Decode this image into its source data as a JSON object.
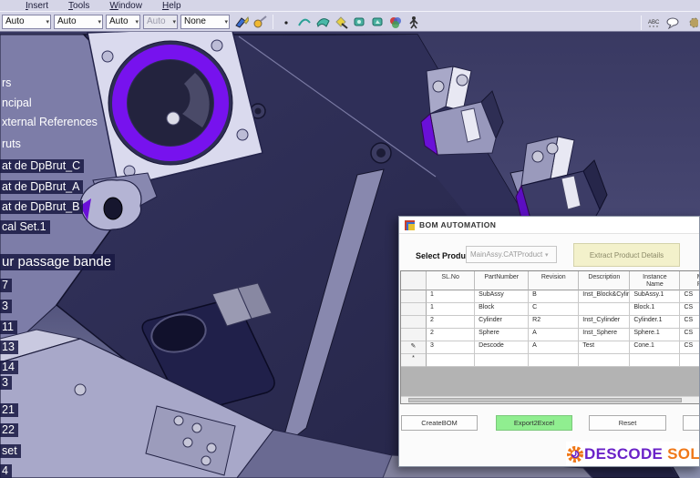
{
  "menu_bar": {
    "items": [
      {
        "label": "Insert"
      },
      {
        "label": "Tools"
      },
      {
        "label": "Window"
      },
      {
        "label": "Help"
      }
    ]
  },
  "toolbar": {
    "dropdowns": [
      {
        "value": "Auto",
        "disabled": false
      },
      {
        "value": "Auto",
        "disabled": false
      },
      {
        "value": "Auto",
        "disabled": false
      },
      {
        "value": "Auto",
        "disabled": true
      },
      {
        "value": "None",
        "disabled": false
      }
    ],
    "icons": [
      "paint-brush",
      "airbrush",
      "point",
      "curve",
      "surface",
      "gem-pencil",
      "render-view",
      "render-view-alt",
      "materials",
      "mannequin",
      "abc-text",
      "speech-balloon",
      "partial-gear"
    ]
  },
  "tree": {
    "items": [
      {
        "label": "rs"
      },
      {
        "label": "ncipal"
      },
      {
        "label": "xternal References"
      },
      {
        "label": "ruts"
      },
      {
        "label": "at de DpBrut_C"
      },
      {
        "label": "at de DpBrut_A"
      },
      {
        "label": "at de DpBrut_B"
      },
      {
        "label": "cal Set.1"
      },
      {
        "label": "ur passage bande"
      },
      {
        "label": "7"
      },
      {
        "label": "3"
      },
      {
        "label": "11"
      },
      {
        "label": "13"
      },
      {
        "label": "14"
      },
      {
        "label": "3"
      },
      {
        "label": "21"
      },
      {
        "label": "22"
      },
      {
        "label": "set"
      },
      {
        "label": "4"
      }
    ]
  },
  "viewport": {
    "colors": {
      "background_top": "#3A3A62",
      "background_bottom": "#8B90AE",
      "part_dark_navy": "#28284E",
      "part_light_face": "#D9D9EC",
      "bore_accent_purple": "#7712EE"
    }
  },
  "dialog": {
    "title": "BOM AUTOMATION",
    "select_product_label": "Select Product",
    "product_combo_value": "MainAssy.CATProduct",
    "extract_button_label": "Extract Product Details",
    "grid": {
      "columns": [
        "SL.No",
        "PartNumber",
        "Revision",
        "Description",
        "Instance\nName",
        "M\nP."
      ],
      "rows": [
        {
          "sl": "1",
          "part": "SubAssy",
          "rev": "B",
          "desc": "Inst_Block&Cylin...",
          "inst": "SubAssy.1",
          "mp": "CS"
        },
        {
          "sl": "1",
          "part": "Block",
          "rev": "C",
          "desc": "",
          "inst": "Block.1",
          "mp": "CS"
        },
        {
          "sl": "2",
          "part": "Cylinder",
          "rev": "R2",
          "desc": "Inst_Cylinder",
          "inst": "Cylinder.1",
          "mp": "CS"
        },
        {
          "sl": "2",
          "part": "Sphere",
          "rev": "A",
          "desc": "Inst_Sphere",
          "inst": "Sphere.1",
          "mp": "CS"
        },
        {
          "sl": "3",
          "part": "Descode",
          "rev": "A",
          "desc": "Test",
          "inst": "Cone.1",
          "mp": "CS"
        }
      ],
      "edit_row_indicator": "✎",
      "new_row_indicator": "*"
    },
    "buttons": [
      {
        "label": "CreateBOM"
      },
      {
        "label": "Export2Excel",
        "color": "#90EE90"
      },
      {
        "label": "Reset"
      }
    ],
    "logo": {
      "text_primary": "DESCODE",
      "text_secondary": "SOL",
      "primary_color": "#6A22C8",
      "secondary_color": "#F07818"
    }
  }
}
